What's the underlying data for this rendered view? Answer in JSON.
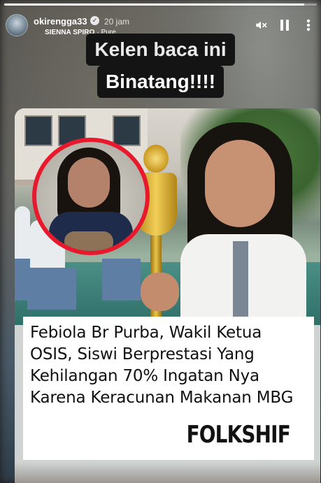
{
  "story": {
    "progress_fraction": 0.96
  },
  "header": {
    "username": "okirengga33",
    "verified_icon": "verified-badge-icon",
    "time": "20 jam",
    "music": {
      "artist": "SIENNA SPIRO",
      "separator": "·",
      "track": "Pure"
    },
    "controls": {
      "mute_icon": "speaker-muted-icon",
      "pause_icon": "pause-icon",
      "more_icon": "more-vertical-icon"
    }
  },
  "caption": {
    "line1": "Kelen baca ini",
    "line2": "Binatang!!!!"
  },
  "post": {
    "body": "Febiola Br Purba, Wakil Ketua OSIS, Siswi Berprestasi Yang Kehilangan 70% Ingatan Nya Karena Keracunan Makanan MBG",
    "brand": "FOLKSHIF",
    "inset_border_color": "#e8192c"
  }
}
